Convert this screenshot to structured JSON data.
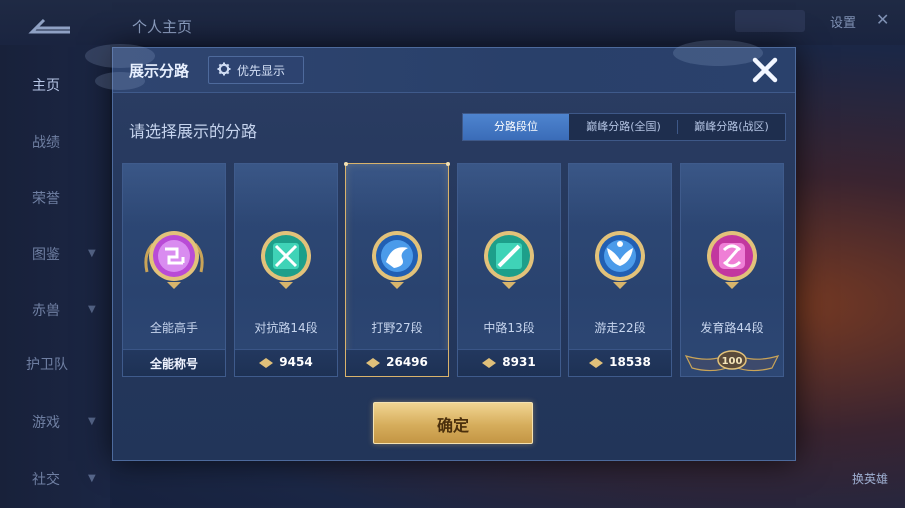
{
  "background": {
    "page_title": "个人主页",
    "settings_label": "设置",
    "nav_items": [
      {
        "label": "主页",
        "active": true
      },
      {
        "label": "战绩"
      },
      {
        "label": "荣誉"
      },
      {
        "label": "图鉴"
      },
      {
        "label": "赤兽"
      },
      {
        "label": "护卫队"
      },
      {
        "label": "游戏"
      },
      {
        "label": "社交"
      }
    ],
    "hero_button": "换英雄"
  },
  "modal": {
    "title": "展示分路",
    "pref_button": "优先显示",
    "subtitle": "请选择展示的分路",
    "tabs": [
      {
        "label": "分路段位",
        "active": true
      },
      {
        "label": "巅峰分路(全国)"
      },
      {
        "label": "巅峰分路(战区)"
      }
    ],
    "cards": [
      {
        "name": "全能高手",
        "bar_label": "全能称号",
        "badge_color": "#b94bd6",
        "icon": "swirl-icon"
      },
      {
        "name": "对抗路14段",
        "score": "9454",
        "badge_color": "#27b8a0",
        "icon": "crossed-swords-icon"
      },
      {
        "name": "打野27段",
        "score": "26496",
        "selected": true,
        "badge_color": "#2f7fd6",
        "icon": "dragon-icon"
      },
      {
        "name": "中路13段",
        "score": "8931",
        "badge_color": "#27b8a0",
        "icon": "slash-icon"
      },
      {
        "name": "游走22段",
        "score": "18538",
        "badge_color": "#2f7fd6",
        "icon": "wings-icon"
      },
      {
        "name": "发育路44段",
        "rank_badge": "100",
        "badge_color": "#d84fb8",
        "icon": "bow-icon"
      }
    ],
    "confirm_button": "确定"
  },
  "colors": {
    "accent_gold": "#d6ad5c",
    "tab_active": "#3a6cb8",
    "modal_bg": "#24375c"
  }
}
